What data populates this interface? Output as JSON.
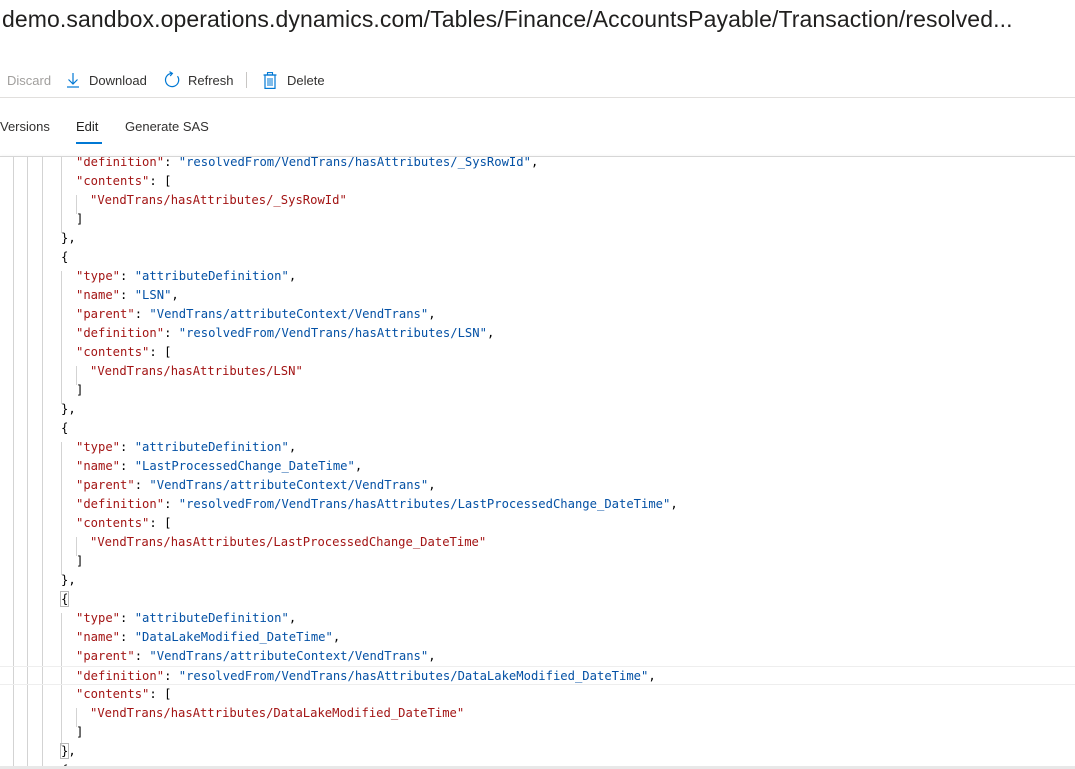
{
  "title": "demo.sandbox.operations.dynamics.com/Tables/Finance/AccountsPayable/Transaction/resolved...",
  "toolbar": {
    "discard_label": "Discard",
    "download_label": "Download",
    "refresh_label": "Refresh",
    "delete_label": "Delete"
  },
  "tabs": {
    "versions_label": "Versions",
    "edit_label": "Edit",
    "generate_sas_label": "Generate SAS",
    "active": "Edit"
  },
  "colors": {
    "accent": "#0078d4",
    "json_key": "#a31515",
    "json_string_value": "#0451a5",
    "json_array_string": "#a31515"
  },
  "code": {
    "lines": [
      "\"definition\": \"resolvedFrom/VendTrans/hasAttributes/_SysRowId\",",
      "\"contents\": [",
      "\"VendTrans/hasAttributes/_SysRowId\"",
      "]",
      "},",
      "{",
      "\"type\": \"attributeDefinition\",",
      "\"name\": \"LSN\",",
      "\"parent\": \"VendTrans/attributeContext/VendTrans\",",
      "\"definition\": \"resolvedFrom/VendTrans/hasAttributes/LSN\",",
      "\"contents\": [",
      "\"VendTrans/hasAttributes/LSN\"",
      "]",
      "},",
      "{",
      "\"type\": \"attributeDefinition\",",
      "\"name\": \"LastProcessedChange_DateTime\",",
      "\"parent\": \"VendTrans/attributeContext/VendTrans\",",
      "\"definition\": \"resolvedFrom/VendTrans/hasAttributes/LastProcessedChange_DateTime\",",
      "\"contents\": [",
      "\"VendTrans/hasAttributes/LastProcessedChange_DateTime\"",
      "]",
      "},",
      "{",
      "\"type\": \"attributeDefinition\",",
      "\"name\": \"DataLakeModified_DateTime\",",
      "\"parent\": \"VendTrans/attributeContext/VendTrans\",",
      "\"definition\": \"resolvedFrom/VendTrans/hasAttributes/DataLakeModified_DateTime\",",
      "\"contents\": [",
      "\"VendTrans/hasAttributes/DataLakeModified_DateTime\"",
      "]",
      "},",
      "{"
    ]
  }
}
